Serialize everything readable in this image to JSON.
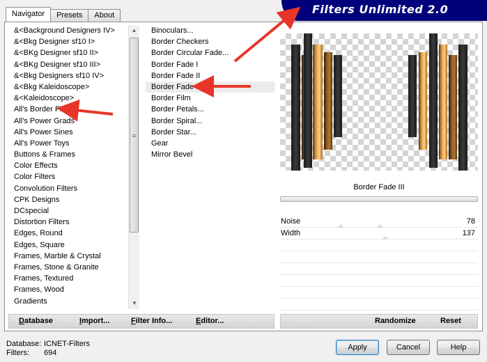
{
  "tabs": [
    "Navigator",
    "Presets",
    "About"
  ],
  "title": "Filters Unlimited 2.0",
  "categories": [
    "&<Background Designers IV>",
    "&<Bkg Designer sf10 I>",
    "&<BKg Designer sf10 II>",
    "&<BKg Designer sf10 III>",
    "&<Bkg Designers sf10 IV>",
    "&<Bkg Kaleidoscope>",
    "&<Kaleidoscope>",
    "All's Border FX",
    "All's Power Grads",
    "All's Power Sines",
    "All's Power Toys",
    "Buttons & Frames",
    "Color Effects",
    "Color Filters",
    "Convolution Filters",
    "CPK Designs",
    "DCspecial",
    "Distortion Filters",
    "Edges, Round",
    "Edges, Square",
    "Frames, Marble & Crystal",
    "Frames, Stone & Granite",
    "Frames, Textured",
    "Frames, Wood",
    "Gradients"
  ],
  "filters": [
    "Binoculars...",
    "Border Checkers",
    "Border Circular Fade...",
    "Border Fade I",
    "Border Fade II",
    "Border Fade III",
    "Border Film",
    "Border Petals...",
    "Border Spiral...",
    "Border Star...",
    "Gear",
    "Mirror Bevel"
  ],
  "selected_filter": "Border Fade III",
  "params": [
    {
      "name": "Noise",
      "value": "78"
    },
    {
      "name": "Width",
      "value": "137"
    }
  ],
  "toolbar_left": [
    {
      "accel": "D",
      "rest": "atabase"
    },
    {
      "accel": "I",
      "rest": "mport..."
    },
    {
      "accel": "F",
      "rest": "ilter Info..."
    },
    {
      "accel": "E",
      "rest": "ditor..."
    }
  ],
  "toolbar_right": {
    "randomize": "Randomize",
    "reset": "Reset"
  },
  "status": {
    "database_label": "Database:",
    "database_value": "ICNET-Filters",
    "filters_label": "Filters:",
    "filters_value": "694"
  },
  "buttons": {
    "apply": "Apply",
    "cancel": "Cancel",
    "help": "Help"
  },
  "colors": {
    "banner": "#00007a",
    "arrow": "#e8352a",
    "accent_orange": "#e09a45"
  },
  "icons": [
    "scroll-up-icon",
    "scroll-grip-icon",
    "scroll-down-icon",
    "red-arrow-icon"
  ]
}
